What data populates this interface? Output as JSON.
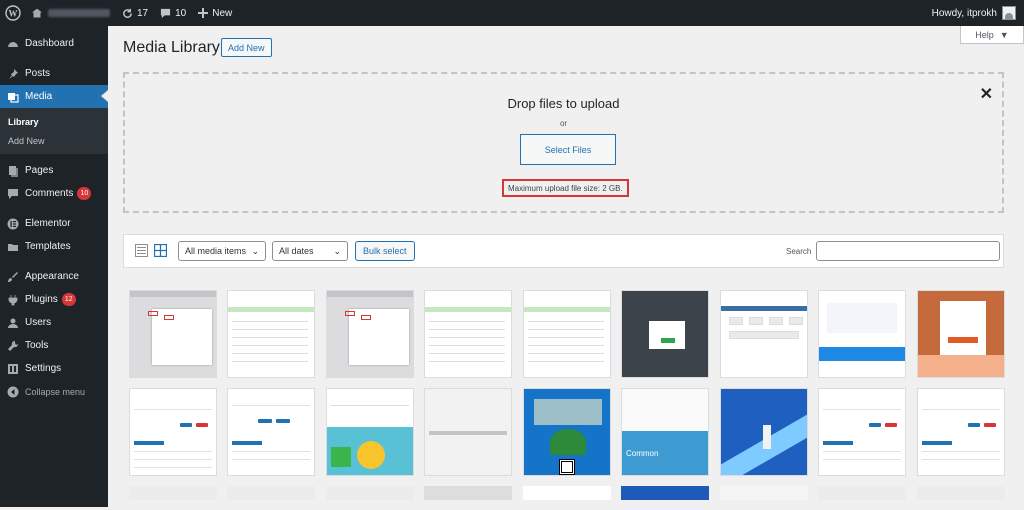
{
  "adminbar": {
    "updates_count": "17",
    "comments_count": "10",
    "new_label": "New",
    "greeting": "Howdy, itprokh"
  },
  "sidebar": {
    "items": [
      {
        "label": "Dashboard",
        "icon": "dashboard-icon"
      },
      {
        "label": "Posts",
        "icon": "pin-icon"
      },
      {
        "label": "Media",
        "icon": "media-icon"
      },
      {
        "label": "Pages",
        "icon": "page-icon"
      },
      {
        "label": "Comments",
        "icon": "comment-icon",
        "badge": "10"
      },
      {
        "label": "Elementor",
        "icon": "elementor-icon"
      },
      {
        "label": "Templates",
        "icon": "folder-icon"
      },
      {
        "label": "Appearance",
        "icon": "brush-icon"
      },
      {
        "label": "Plugins",
        "icon": "plug-icon",
        "badge": "12"
      },
      {
        "label": "Users",
        "icon": "user-icon"
      },
      {
        "label": "Tools",
        "icon": "wrench-icon"
      },
      {
        "label": "Settings",
        "icon": "settings-icon"
      }
    ],
    "submenu": {
      "library": "Library",
      "add_new": "Add New"
    },
    "collapse_label": "Collapse menu"
  },
  "header": {
    "title": "Media Library",
    "add_new": "Add New",
    "help": "Help"
  },
  "uploader": {
    "drop_text": "Drop files to upload",
    "or_text": "or",
    "select_files": "Select Files",
    "max_size": "Maximum upload file size: 2 GB."
  },
  "toolbar": {
    "filter_type": "All media items",
    "filter_date": "All dates",
    "bulk_select": "Bulk select",
    "search_label": "Search",
    "search_value": ""
  },
  "thumbs": {
    "sky_label": "Common"
  },
  "colors": {
    "adminbar_bg": "#1d2327",
    "sidebar_bg": "#1d2327",
    "accent": "#2271b1",
    "badge": "#d63638",
    "highlight": "#d63638"
  }
}
